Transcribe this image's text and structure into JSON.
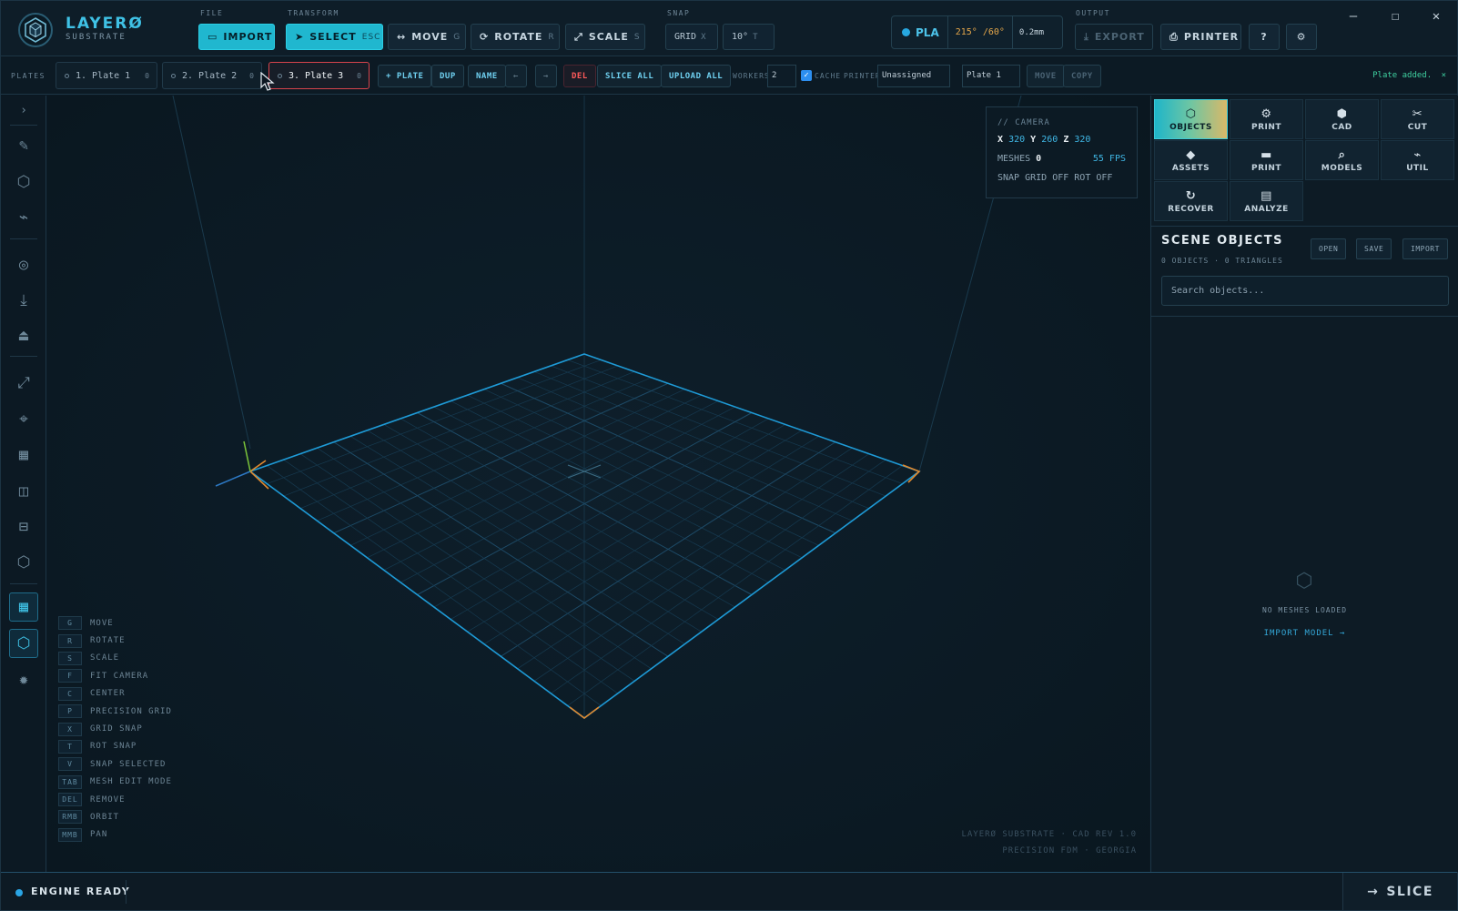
{
  "app": {
    "name": "LAYERØ",
    "subtitle": "SUBSTRATE"
  },
  "toolbar": {
    "file_label": "FILE",
    "transform_label": "TRANSFORM",
    "snap_label": "SNAP",
    "output_label": "OUTPUT",
    "import": "IMPORT",
    "select": "SELECT",
    "select_key": "ESC",
    "move": "MOVE",
    "move_key": "G",
    "rotate": "ROTATE",
    "rotate_key": "R",
    "scale": "SCALE",
    "scale_key": "S",
    "grid": "GRID",
    "grid_key": "X",
    "rot_snap": "10°",
    "rot_snap_key": "T",
    "export": "EXPORT",
    "printer": "PRINTER",
    "help": "?"
  },
  "material": {
    "name": "PLA",
    "temps": "215° /60°",
    "layer": "0.2mm",
    "color": "#27a7e0"
  },
  "plates_bar": {
    "label": "PLATES",
    "plates": [
      {
        "label": "1. Plate 1",
        "count": "0"
      },
      {
        "label": "2. Plate 2",
        "count": "0"
      },
      {
        "label": "3. Plate 3",
        "count": "0"
      }
    ],
    "add_plate": "+ PLATE",
    "dup": "DUP",
    "name": "NAME",
    "prev": "←",
    "next": "→",
    "del": "DEL",
    "slice_all": "SLICE ALL",
    "upload_all": "UPLOAD ALL",
    "workers_label": "WORKERS",
    "workers_value": "2",
    "cache_label": "CACHE",
    "printer_label": "PRINTER",
    "printer_value": "Unassigned",
    "target_plate": "Plate 1",
    "move": "MOVE",
    "copy": "COPY",
    "status": "Plate added.",
    "status_close": "×"
  },
  "camera": {
    "header": "// CAMERA",
    "x_label": "X",
    "x": "320",
    "y_label": "Y",
    "y": "260",
    "z_label": "Z",
    "z": "320",
    "meshes_label": "MESHES",
    "meshes": "0",
    "fps": "55 FPS",
    "snap_status": "SNAP GRID OFF ROT OFF"
  },
  "shortcuts": [
    {
      "key": "G",
      "label": "MOVE"
    },
    {
      "key": "R",
      "label": "ROTATE"
    },
    {
      "key": "S",
      "label": "SCALE"
    },
    {
      "key": "F",
      "label": "FIT CAMERA"
    },
    {
      "key": "C",
      "label": "CENTER"
    },
    {
      "key": "P",
      "label": "PRECISION GRID"
    },
    {
      "key": "X",
      "label": "GRID SNAP"
    },
    {
      "key": "T",
      "label": "ROT SNAP"
    },
    {
      "key": "V",
      "label": "SNAP SELECTED"
    },
    {
      "key": "TAB",
      "label": "MESH EDIT MODE"
    },
    {
      "key": "DEL",
      "label": "REMOVE"
    },
    {
      "key": "RMB",
      "label": "ORBIT"
    },
    {
      "key": "MMB",
      "label": "PAN"
    }
  ],
  "footer": {
    "line1": "LAYERØ SUBSTRATE · CAD REV 1.0",
    "line2": "PRECISION FDM · GEORGIA"
  },
  "panel_tabs": [
    {
      "label": "OBJECTS",
      "icon": "hexagon-icon"
    },
    {
      "label": "PRINT",
      "icon": "gear-icon"
    },
    {
      "label": "CAD",
      "icon": "cube-icon"
    },
    {
      "label": "CUT",
      "icon": "scissors-icon"
    },
    {
      "label": "ASSETS",
      "icon": "diamond-icon"
    },
    {
      "label": "PRINT",
      "icon": "nozzle-icon"
    },
    {
      "label": "MODELS",
      "icon": "search-icon"
    },
    {
      "label": "UTIL",
      "icon": "wrench-icon"
    },
    {
      "label": "RECOVER",
      "icon": "refresh-icon"
    },
    {
      "label": "ANALYZE",
      "icon": "layers-icon"
    }
  ],
  "scene": {
    "title": "SCENE OBJECTS",
    "subtitle": "0 OBJECTS · 0 TRIANGLES",
    "open": "OPEN",
    "save": "SAVE",
    "import": "IMPORT",
    "search_placeholder": "Search objects...",
    "empty": "NO MESHES LOADED",
    "import_link": "IMPORT MODEL →"
  },
  "statusbar": {
    "engine": "ENGINE READY",
    "slice": "SLICE"
  }
}
